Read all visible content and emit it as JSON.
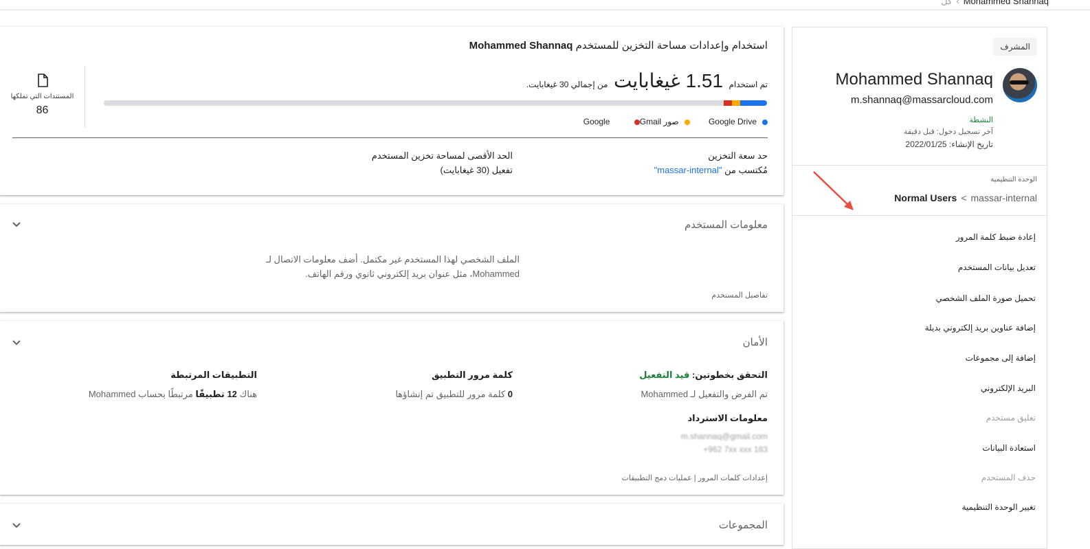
{
  "breadcrumb": {
    "previous": "كل",
    "current": "Mohammed Shannaq"
  },
  "side": {
    "role": "المشرف",
    "name": "Mohammed Shannaq",
    "email": "m.shannaq@massarcloud.com",
    "status": "النشطة",
    "last_login": "آخر تسجيل دخول: قبل دقيقة",
    "created": "تاريخ الإنشاء: 2022/01/25",
    "ou_label": "الوحدة التنظيمية",
    "ou_current": "Normal Users",
    "ou_arrow": "<",
    "ou_root": "massar-internal",
    "actions": {
      "reset_password": "إعادة ضبط كلمة المرور",
      "edit_user": "تعديل بيانات المستخدم",
      "upload_photo": "تحميل صورة الملف الشخصي",
      "add_alt_email": "إضافة عناوين بريد إلكتروني بديلة",
      "add_groups": "إضافة إلى مجموعات",
      "email": "البريد الإلكتروني",
      "suspend": "تعليق مستخدم",
      "restore": "استعادة البيانات",
      "delete": "حذف المستخدم",
      "change_ou": "تغيير الوحدة التنظيمية"
    }
  },
  "storage": {
    "title_prefix": "استخدام وإعدادات مساحة التخزين للمستخدم",
    "title_name": "Mohammed Shannaq",
    "used_prefix": "تم استخدام",
    "used_value": "1.51 غيغابايت",
    "used_suffix": "من إجمالي 30 غيغابايت.",
    "usage": {
      "drive": 0.04,
      "photos": 0.012,
      "gmail": 0.012
    },
    "legend": {
      "drive": "Google Drive",
      "photos": "صور Google",
      "gmail": "Gmail"
    },
    "colors": {
      "drive": "#1a73e8",
      "photos": "#f9ab00",
      "gmail": "#d93025"
    },
    "docs_label": "المستندات التي تملكها",
    "docs_count": "86",
    "cap_heading": "حد سعة التخزين",
    "cap_value_prefix": "مُكتسب من",
    "cap_value_link": "\"massar-internal\"",
    "limit_heading": "الحد الأقصى لمساحة تخزين المستخدم",
    "limit_value": "تفعيل (30 غيغابايت)"
  },
  "user_info": {
    "title": "معلومات المستخدم",
    "message": "الملف الشخصي لهذا المستخدم غير مكتمل. أضف معلومات الاتصال لـ Mohammed، مثل عنوان بريد إلكتروني ثانوي ورقم الهاتف.",
    "footer": "تفاصيل المستخدم"
  },
  "security": {
    "title": "الأمان",
    "two_step_label": "التحقق بخطوتين:",
    "two_step_status": "قيد التفعيل",
    "two_step_value": "تم الفرض والتفعيل لـ Mohammed",
    "app_password_heading": "كلمة مرور التطبيق",
    "app_password_count": "0",
    "app_password_value": "كلمة مرور للتطبيق تم إنشاؤها",
    "linked_apps_heading": "التطبيقات المرتبطة",
    "linked_apps_pre": "هناك",
    "linked_apps_count": "12 تطبيقًا",
    "linked_apps_post": "مرتبطًا بحساب Mohammed",
    "recovery_heading": "معلومات الاسترداد",
    "recovery_email": "m.shannaq@gmail.com",
    "recovery_phone": "+962 7xx xxx 183",
    "footer": "إعدادات كلمات المرور | عمليات دمج التطبيقات"
  },
  "groups": {
    "title": "المجموعات"
  }
}
